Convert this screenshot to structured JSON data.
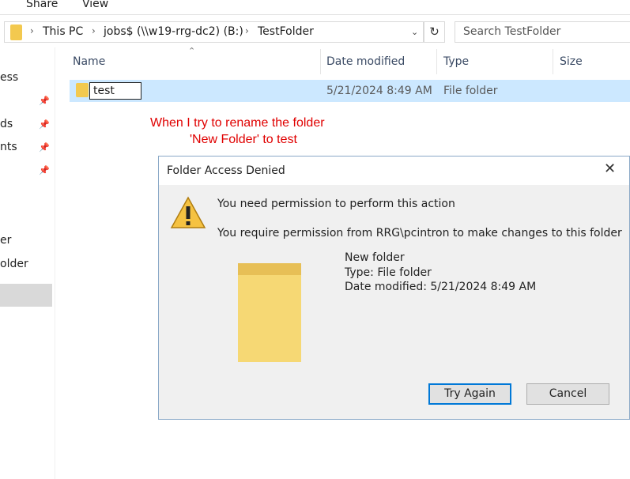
{
  "ribbon": {
    "tabs": [
      "Share",
      "View"
    ]
  },
  "address_bar": {
    "crumbs": [
      "This PC",
      "jobs$ (\\\\w19-rrg-dc2) (B:)",
      "TestFolder"
    ]
  },
  "search": {
    "placeholder": "Search TestFolder"
  },
  "nav_pane": {
    "items": [
      "ess",
      "ds",
      "nts",
      "er",
      "older"
    ]
  },
  "file_list": {
    "columns": [
      "Name",
      "Date modified",
      "Type",
      "Size"
    ],
    "rows": [
      {
        "name": "test",
        "date_modified": "5/21/2024 8:49 AM",
        "type": "File folder"
      }
    ]
  },
  "annotation": {
    "lines": [
      "When I try to rename the folder",
      "'New Folder' to test"
    ],
    "color": "#e00000"
  },
  "dialog": {
    "title": "Folder Access Denied",
    "heading": "You need permission to perform this action",
    "detail": "You require permission from RRG\\pcintron to make changes to this folder",
    "item_name": "New folder",
    "item_type": "Type: File folder",
    "item_date": "Date modified: 5/21/2024 8:49 AM",
    "buttons": {
      "try_again": "Try Again",
      "cancel": "Cancel"
    }
  },
  "colors": {
    "selection": "#cce8ff",
    "accent": "#0078d7",
    "folder": "#f3c94f"
  }
}
